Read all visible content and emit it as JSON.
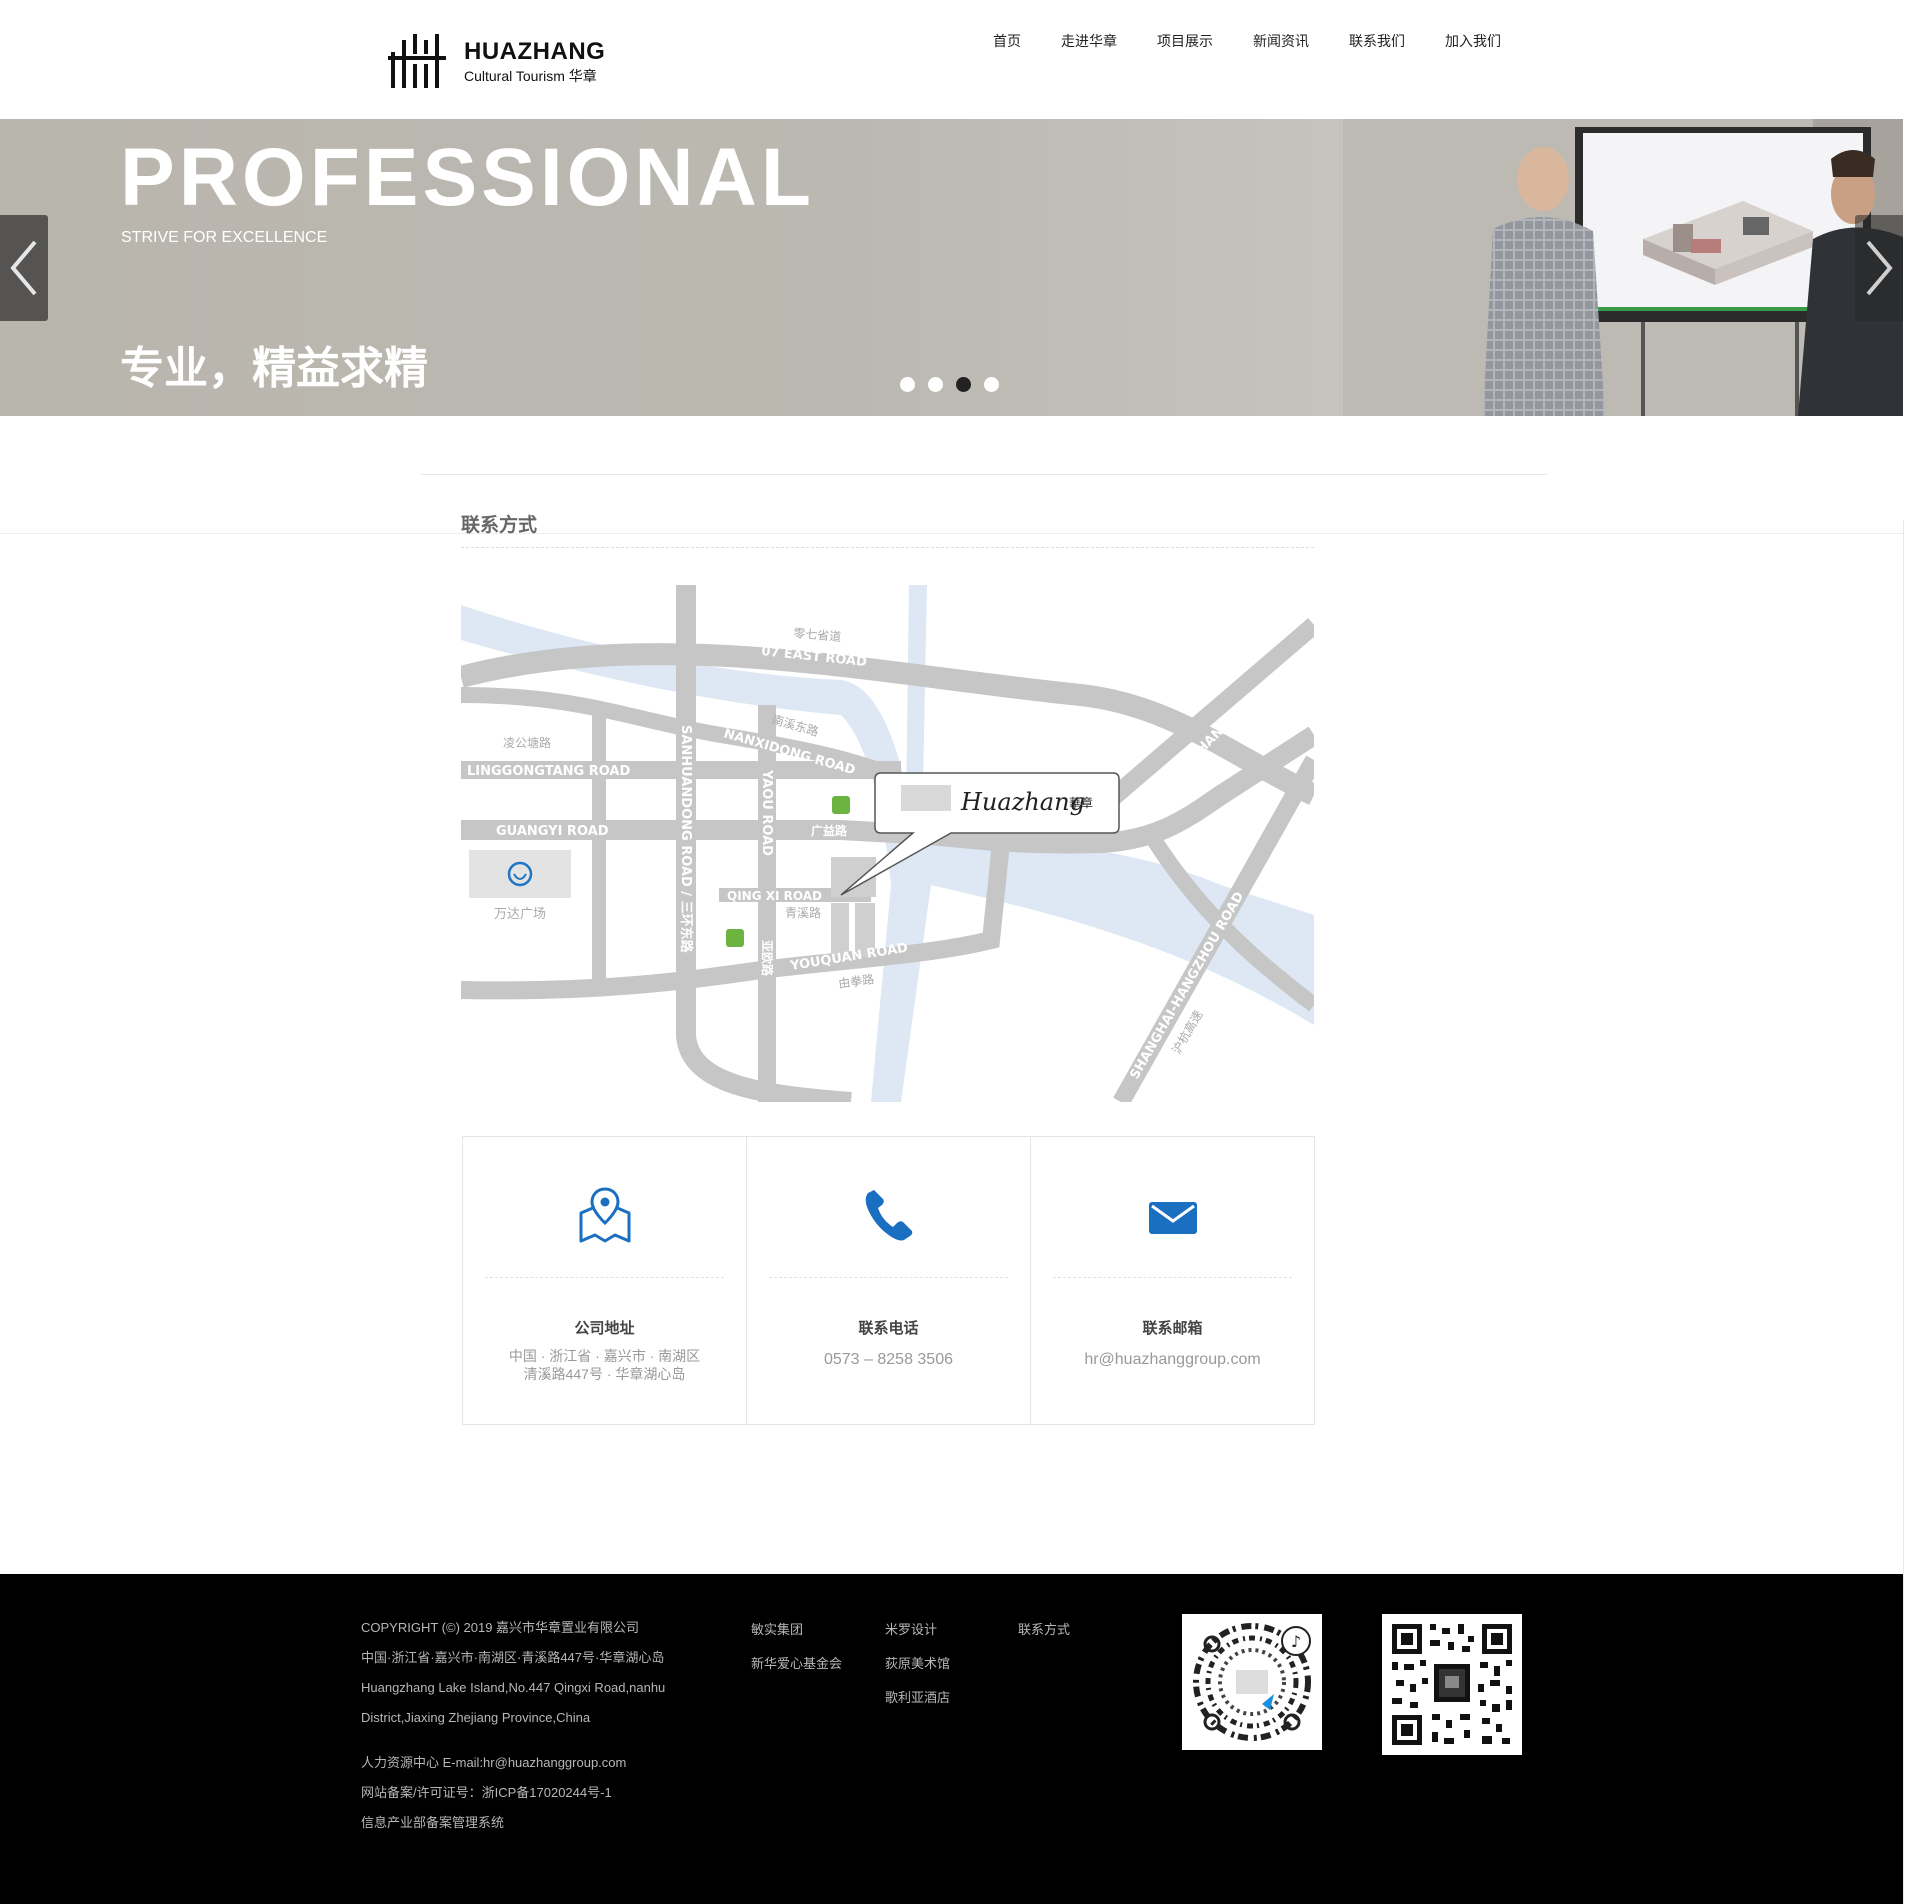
{
  "header": {
    "brand": "HUAZHANG",
    "tagline": "Cultural Tourism 华章",
    "nav": [
      "首页",
      "走进华章",
      "项目展示",
      "新闻资讯",
      "联系我们",
      "加入我们"
    ]
  },
  "banner": {
    "headline": "PROFESSIONAL",
    "subline": "STRIVE FOR EXCELLENCE",
    "chinese": "专业，精益求精",
    "slide_count": 4,
    "active_slide": 3
  },
  "contact": {
    "title": "联系方式",
    "map_labels": {
      "road_07": "07 EAST ROAD",
      "road_07_cn": "零七省道",
      "nanxi": "NANXIDONG ROAD",
      "nanxi_cn": "南溪东路",
      "lingong": "LINGGONGTANG ROAD",
      "lingong_cn": "凌公塘路",
      "guangyi": "GUANGYI ROAD",
      "guangyi_cn": "广益路",
      "sanhuan": "SANHUANDONG ROAD / 三环东路",
      "yaou": "YAOU ROAD",
      "yaou_cn": "亚欧路",
      "qingxi": "QING XI ROAD",
      "qingxi_cn": "青溪路",
      "youquan": "YOUQUAN ROAD",
      "youquan_cn": "由拳路",
      "jiashan": "JIASHAN ROAD",
      "shanghai": "SHANGHAI-HANGZHOU ROAD",
      "shanghai_cn": "沪杭高速",
      "wanda": "万达广场",
      "bubble_script": "Huazhang",
      "bubble_cn": "華章"
    },
    "cards": [
      {
        "icon": "map-pin-icon",
        "title": "公司地址",
        "lines": [
          "中国 · 浙江省 · 嘉兴市 · 南湖区",
          "清溪路447号 · 华章湖心岛"
        ]
      },
      {
        "icon": "phone-icon",
        "title": "联系电话",
        "lines": [
          "0573 – 8258 3506"
        ]
      },
      {
        "icon": "envelope-icon",
        "title": "联系邮箱",
        "lines": [
          "hr@huazhanggroup.com"
        ]
      }
    ]
  },
  "footer": {
    "lines": [
      "COPYRIGHT (©) 2019 嘉兴市华章置业有限公司",
      "中国·浙江省·嘉兴市·南湖区·青溪路447号·华章湖心岛",
      "Huangzhang Lake Island,No.447 Qingxi Road,nanhu",
      "District,Jiaxing Zhejiang Province,China"
    ],
    "lines2": [
      "人力资源中心 E-mail:hr@huazhanggroup.com",
      "网站备案/许可证号：浙ICP备17020244号-1",
      "信息产业部备案管理系统"
    ],
    "col1": [
      "敏实集团",
      "新华爱心基金会"
    ],
    "col2": [
      "米罗设计",
      "荻原美术馆",
      "歌利亚酒店"
    ],
    "col3": [
      "联系方式"
    ]
  },
  "colors": {
    "accent_blue": "#1a6fc1",
    "footer_bg": "#000000",
    "banner_bg": "#bbb8b1"
  }
}
